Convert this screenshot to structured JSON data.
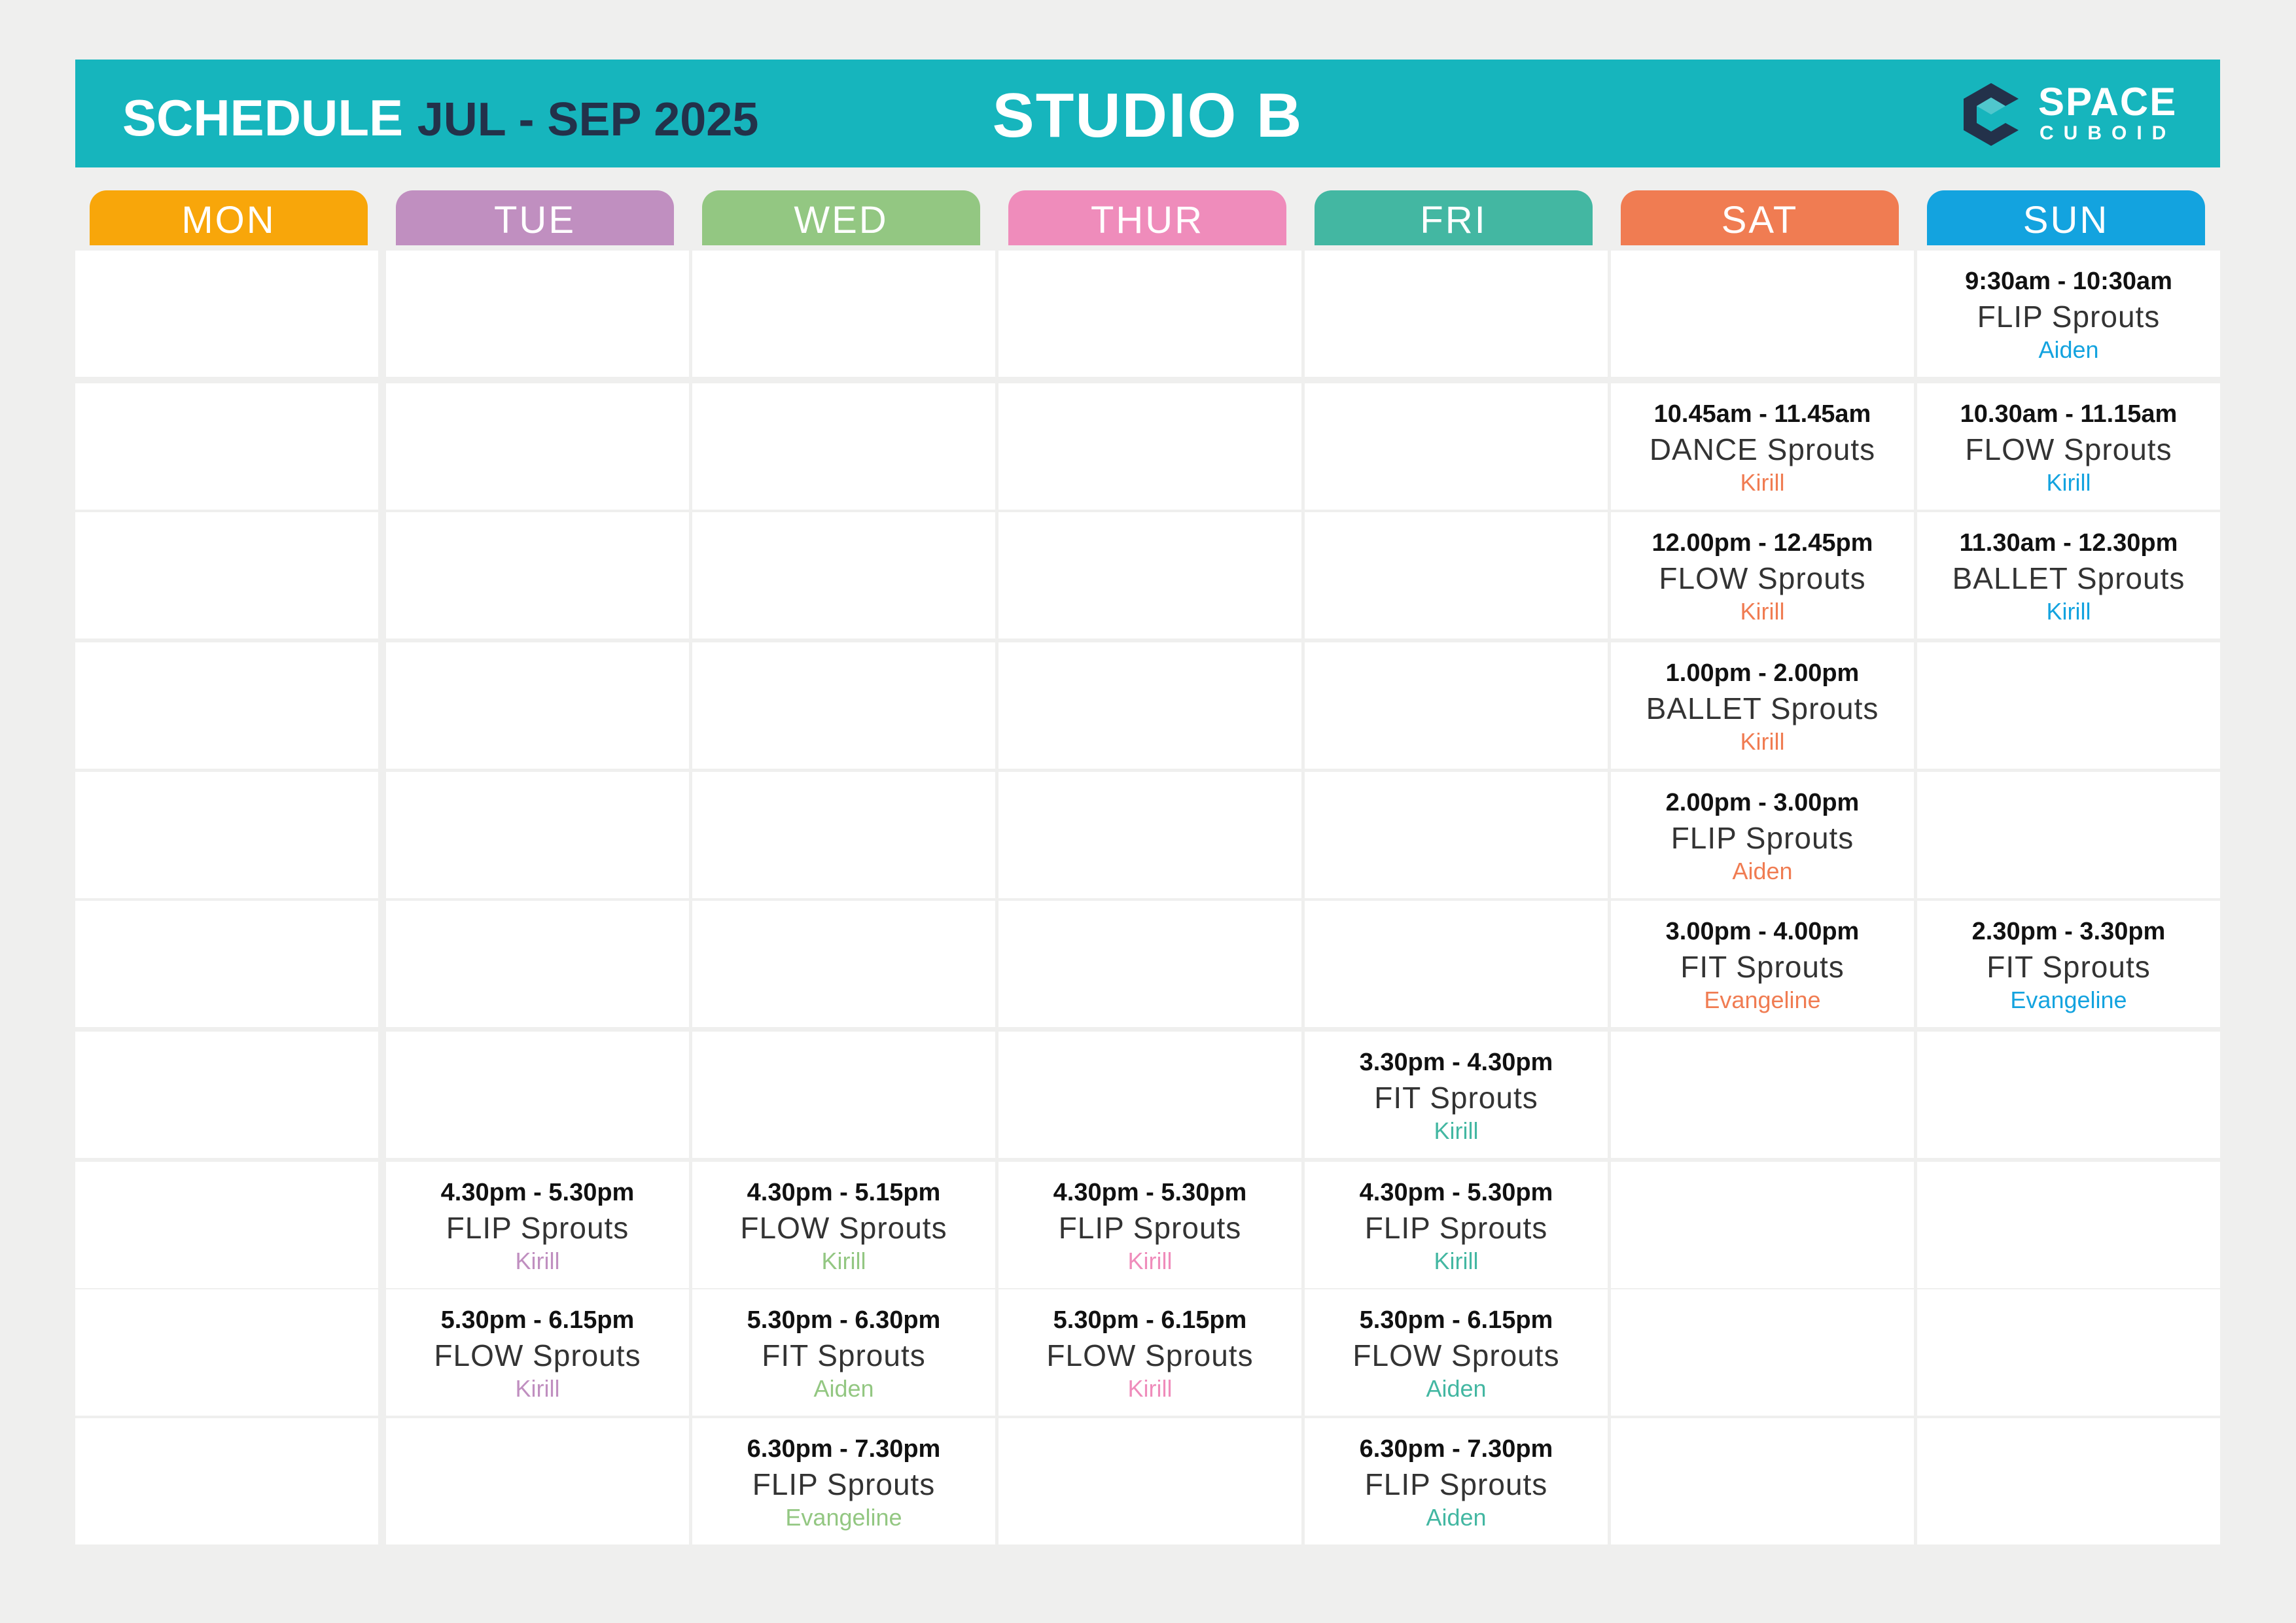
{
  "header": {
    "schedule_label": "SCHEDULE",
    "period": "JUL - SEP 2025",
    "studio": "STUDIO B",
    "logo_word1": "SPACE",
    "logo_word2": "CUBOID",
    "logo_icon": "cube-icon"
  },
  "colors": {
    "header_bg": "#16b5bd",
    "page_bg": "#efefee",
    "mon": "#f8a60a",
    "tue": "#c08fc0",
    "wed": "#93c782",
    "thur": "#ef8cbb",
    "fri": "#43b7a2",
    "sat": "#f07c52",
    "sun": "#13a3df"
  },
  "days": [
    "MON",
    "TUE",
    "WED",
    "THUR",
    "FRI",
    "SAT",
    "SUN"
  ],
  "classes": {
    "sun_0": {
      "time": "9:30am - 10:30am",
      "name": "FLIP Sprouts",
      "instructor": "Aiden"
    },
    "sat_1": {
      "time": "10.45am - 11.45am",
      "name": "DANCE Sprouts",
      "instructor": "Kirill"
    },
    "sun_1": {
      "time": "10.30am - 11.15am",
      "name": "FLOW Sprouts",
      "instructor": "Kirill"
    },
    "sat_2": {
      "time": "12.00pm - 12.45pm",
      "name": "FLOW Sprouts",
      "instructor": "Kirill"
    },
    "sun_2": {
      "time": "11.30am - 12.30pm",
      "name": "BALLET Sprouts",
      "instructor": "Kirill"
    },
    "sat_3": {
      "time": "1.00pm - 2.00pm",
      "name": "BALLET Sprouts",
      "instructor": "Kirill"
    },
    "sat_4": {
      "time": "2.00pm - 3.00pm",
      "name": "FLIP Sprouts",
      "instructor": "Aiden"
    },
    "sat_5": {
      "time": "3.00pm - 4.00pm",
      "name": "FIT Sprouts",
      "instructor": "Evangeline"
    },
    "sun_5": {
      "time": "2.30pm - 3.30pm",
      "name": "FIT Sprouts",
      "instructor": "Evangeline"
    },
    "fri_6": {
      "time": "3.30pm - 4.30pm",
      "name": "FIT Sprouts",
      "instructor": "Kirill"
    },
    "tue_7": {
      "time": "4.30pm - 5.30pm",
      "name": "FLIP Sprouts",
      "instructor": "Kirill"
    },
    "wed_7": {
      "time": "4.30pm - 5.15pm",
      "name": "FLOW Sprouts",
      "instructor": "Kirill"
    },
    "thur_7": {
      "time": "4.30pm - 5.30pm",
      "name": "FLIP Sprouts",
      "instructor": "Kirill"
    },
    "fri_7": {
      "time": "4.30pm - 5.30pm",
      "name": "FLIP Sprouts",
      "instructor": "Kirill"
    },
    "tue_8": {
      "time": "5.30pm - 6.15pm",
      "name": "FLOW Sprouts",
      "instructor": "Kirill"
    },
    "wed_8": {
      "time": "5.30pm - 6.30pm",
      "name": "FIT Sprouts",
      "instructor": "Aiden"
    },
    "thur_8": {
      "time": "5.30pm - 6.15pm",
      "name": "FLOW Sprouts",
      "instructor": "Kirill"
    },
    "fri_8": {
      "time": "5.30pm - 6.15pm",
      "name": "FLOW Sprouts",
      "instructor": "Aiden"
    },
    "wed_9": {
      "time": "6.30pm - 7.30pm",
      "name": "FLIP Sprouts",
      "instructor": "Evangeline"
    },
    "fri_9": {
      "time": "6.30pm - 7.30pm",
      "name": "FLIP Sprouts",
      "instructor": "Aiden"
    }
  }
}
